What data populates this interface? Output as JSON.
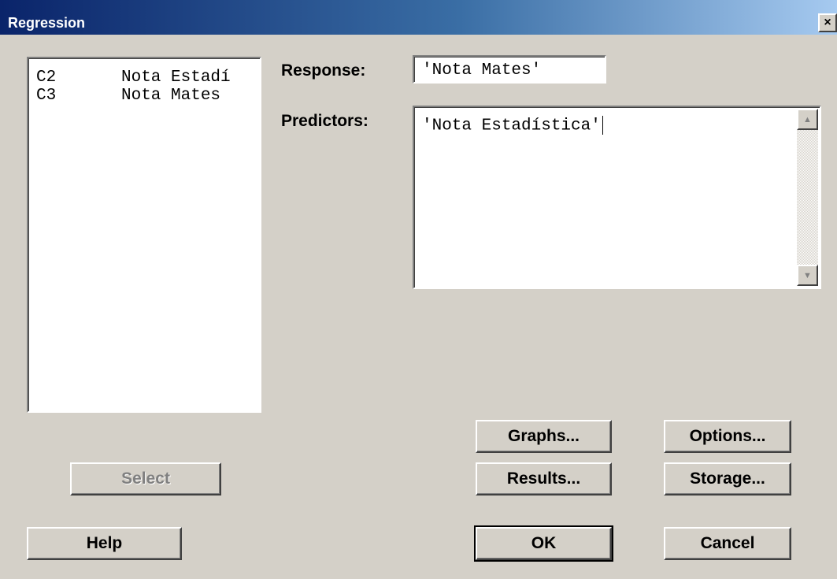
{
  "window": {
    "title": "Regression",
    "close_label": "×"
  },
  "columns": [
    {
      "id": "C2",
      "name": "Nota Estadí"
    },
    {
      "id": "C3",
      "name": "Nota Mates"
    }
  ],
  "response": {
    "label": "Response:",
    "value": "'Nota Mates'"
  },
  "predictors": {
    "label": "Predictors:",
    "value": "'Nota Estadística'"
  },
  "buttons": {
    "select": "Select",
    "help": "Help",
    "graphs": "Graphs...",
    "options": "Options...",
    "results": "Results...",
    "storage": "Storage...",
    "ok": "OK",
    "cancel": "Cancel"
  },
  "scroll_icons": {
    "up": "▲",
    "down": "▼"
  }
}
